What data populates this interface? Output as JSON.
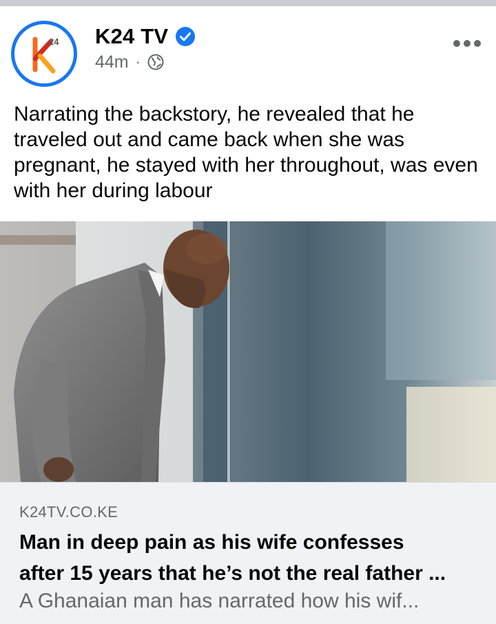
{
  "post": {
    "page_name": "K24 TV",
    "time": "44m",
    "separator": "·",
    "text": "Narrating the backstory, he revealed that he traveled out and came back when she was pregnant, he stayed with her throughout, was even with her during labour"
  },
  "avatar": {
    "logo_letter": "k",
    "logo_number": "24"
  },
  "link_preview": {
    "domain": "K24TV.CO.KE",
    "headline_line1": "Man in deep pain as his wife confesses",
    "headline_line2": "after 15 years that he’s not the real father ...",
    "description": "A Ghanaian man has narrated how his wif..."
  },
  "colors": {
    "accent": "#1877f2",
    "secondary_text": "#65676b",
    "card_bg": "#f0f2f5"
  },
  "icons": [
    "verified-badge-icon",
    "globe-icon",
    "more-options-icon"
  ]
}
